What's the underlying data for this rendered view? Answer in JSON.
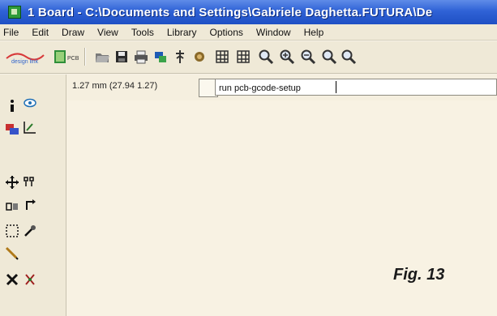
{
  "window": {
    "title": "1 Board - C:\\Documents and Settings\\Gabriele Daghetta.FUTURA\\De"
  },
  "menu": [
    "File",
    "Edit",
    "Draw",
    "View",
    "Tools",
    "Library",
    "Options",
    "Window",
    "Help"
  ],
  "toolbar": {
    "logo1": "design link",
    "logo2": "PCB"
  },
  "status": {
    "coordinates": "1.27 mm (27.94 1.27)"
  },
  "command": {
    "value": "run pcb-gcode-setup"
  },
  "figure_label": "Fig. 13"
}
